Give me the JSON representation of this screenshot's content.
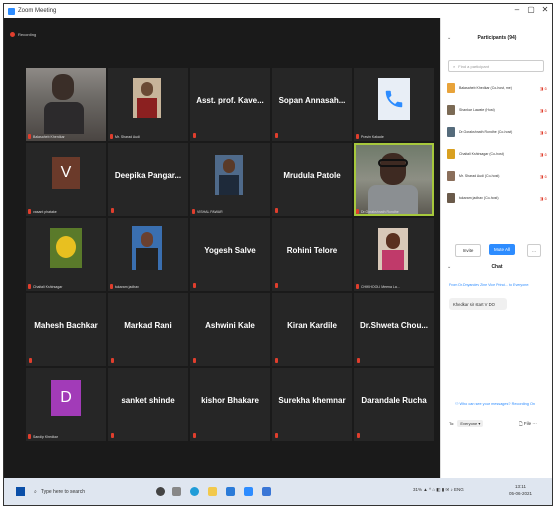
{
  "window": {
    "title": "Zoom Meeting",
    "minimize": "–",
    "maximize": "▢",
    "close": "✕"
  },
  "recording": "Recording",
  "tiles": [
    {
      "display": "",
      "label": "Balasaheb Kherdkar"
    },
    {
      "display": "",
      "label": "Mr. Sharad Audi"
    },
    {
      "display": "Asst. prof. Kave...",
      "label": ""
    },
    {
      "display": "Sopan Annasah...",
      "label": ""
    },
    {
      "display": "",
      "label": "Pravin Kakade"
    },
    {
      "display": "",
      "label": "vasant phatake"
    },
    {
      "display": "Deepika Pangar...",
      "label": ""
    },
    {
      "display": "",
      "label": "VISHAL PAWAR"
    },
    {
      "display": "Mrudula Patole",
      "label": ""
    },
    {
      "display": "",
      "label": "Dr.Gorakshnath Rondhe"
    },
    {
      "display": "",
      "label": "Chaitali Kshirsagar"
    },
    {
      "display": "",
      "label": "tukaram jadhav"
    },
    {
      "display": "Yogesh Salve",
      "label": ""
    },
    {
      "display": "Rohini Telore",
      "label": ""
    },
    {
      "display": "",
      "label": "CHIKHOOLI Meena La..."
    },
    {
      "display": "Mahesh Bachkar",
      "label": ""
    },
    {
      "display": "Markad Rani",
      "label": ""
    },
    {
      "display": "Ashwini Kale",
      "label": ""
    },
    {
      "display": "Kiran Kardile",
      "label": ""
    },
    {
      "display": "Dr.Shweta  Chou...",
      "label": ""
    },
    {
      "display": "",
      "label": "Sandip Khedkar"
    },
    {
      "display": "sanket shinde",
      "label": ""
    },
    {
      "display": "kishor Bhakare",
      "label": ""
    },
    {
      "display": "Surekha khemnar",
      "label": ""
    },
    {
      "display": "Darandale Rucha",
      "label": ""
    }
  ],
  "avatar_letters": {
    "vasant": "V",
    "sandip": "D"
  },
  "participants": {
    "title": "Participants (94)",
    "search_placeholder": "Find a participant",
    "list": [
      {
        "name": "Balasaheb Khedkar (Co-host, me)",
        "color": "#e8a33a"
      },
      {
        "name": "Shankar Lawate (Host)",
        "color": "#7b6a55"
      },
      {
        "name": "Dr.Gorakshnath Rondhe (Co-host)",
        "color": "#556b7b"
      },
      {
        "name": "Chaitali Kshirsagar (Co-host)",
        "color": "#d9a020"
      },
      {
        "name": "Mr. Sharad Audi (Co-host)",
        "color": "#8a6e5a"
      },
      {
        "name": "tukaram jadhav (Co-host)",
        "color": "#6a5a4a"
      }
    ],
    "invite": "Invite",
    "mute_all": "Mute All",
    "more": "..."
  },
  "chat": {
    "title": "Chat",
    "from": "From Dr.Dnyandev Zine Vice Princi... to Everyone:",
    "message": "Khedkar sir start V DO",
    "note": "Who can see your messages? Recording On",
    "to_label": "To:",
    "to_value": "Everyone ▾",
    "file": "File"
  },
  "taskbar": {
    "search": "Type here to search",
    "tray": "31% ▲ ^ ⌂ ◧ ▮ ✉ ♪ ENG",
    "time": "13:11",
    "date": "05-06-2021"
  },
  "colors": {
    "accent": "#2d8cff",
    "mute_red": "#e03e2d",
    "active_speaker": "#a6c83c"
  }
}
